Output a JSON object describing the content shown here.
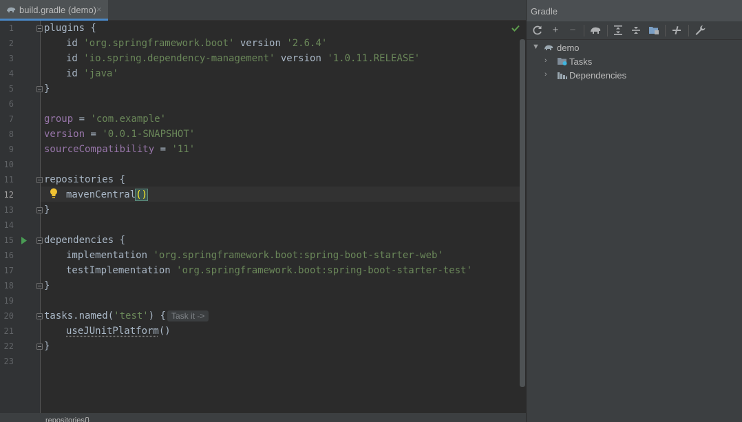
{
  "editor": {
    "tab": {
      "label": "build.gradle (demo)",
      "close": "×"
    },
    "line_numbers": [
      "1",
      "2",
      "3",
      "4",
      "5",
      "6",
      "7",
      "8",
      "9",
      "10",
      "11",
      "12",
      "13",
      "14",
      "15",
      "16",
      "17",
      "18",
      "19",
      "20",
      "21",
      "22",
      "23"
    ],
    "lines": {
      "l1_kw": "plugins {",
      "l2_id": "id ",
      "l2_str": "'org.springframework.boot'",
      "l2_ver": " version ",
      "l2_verstr": "'2.6.4'",
      "l3_id": "id ",
      "l3_str": "'io.spring.dependency-management'",
      "l3_ver": " version ",
      "l3_verstr": "'1.0.11.RELEASE'",
      "l4_id": "id ",
      "l4_str": "'java'",
      "l5": "}",
      "l7_prop": "group",
      "l7_eq": " = ",
      "l7_str": "'com.example'",
      "l8_prop": "version",
      "l8_eq": " = ",
      "l8_str": "'0.0.1-SNAPSHOT'",
      "l9_prop": "sourceCompatibility",
      "l9_eq": " = ",
      "l9_str": "'11'",
      "l11": "repositories {",
      "l12_fn": "mavenCentral",
      "l12_paren": "()",
      "l13": "}",
      "l15": "dependencies {",
      "l16_fn": "implementation ",
      "l16_str": "'org.springframework.boot:spring-boot-starter-web'",
      "l17_fn": "testImplementation ",
      "l17_str": "'org.springframework.boot:spring-boot-starter-test'",
      "l18": "}",
      "l20_fn": "tasks.named(",
      "l20_str": "'test'",
      "l20_end": ") {",
      "l20_hint": "Task it ->",
      "l21_fn": "useJUnitPlatform",
      "l21_paren": "()",
      "l22": "}"
    },
    "breadcrumb": "repositories{}"
  },
  "gradle": {
    "title": "Gradle",
    "toolbar": {
      "reload": "reload-icon",
      "add": "+",
      "remove": "−",
      "execute_task": "gradle-elephant-icon",
      "expand_all": "expand-all-icon",
      "collapse_all": "collapse-all-icon",
      "group_modules": "group-modules-icon",
      "toggle_offline": "offline-toggle-icon",
      "settings": "wrench-icon"
    },
    "tree": {
      "root": "demo",
      "children": [
        "Tasks",
        "Dependencies"
      ]
    }
  },
  "colors": {
    "editor_bg": "#2b2b2b",
    "string": "#6a8759",
    "property": "#9876aa",
    "text": "#a9b7c6",
    "panel_bg": "#3c3f41",
    "accent": "#4a88c7",
    "check": "#5fa04e"
  }
}
